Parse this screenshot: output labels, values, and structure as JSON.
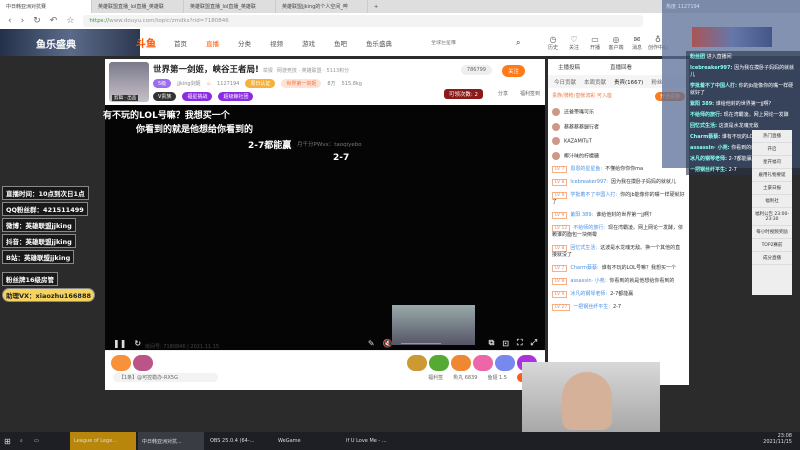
{
  "browser": {
    "tabs": [
      "中日韩亚洲对抗赛",
      "英雄联盟直播_lol直播_英雄联",
      "英雄联盟直播_lol直播_英雄联",
      "英雄联盟jjking的个人空间_哔"
    ],
    "url_secure": "https://",
    "url_rest": "www.douyu.com/topic/zmdks?rid=7180846"
  },
  "site": {
    "banner": "鱼乐盛典",
    "logo": "斗鱼",
    "nav": [
      "首页",
      "直播",
      "分类",
      "视频",
      "游戏",
      "鱼吧",
      "鱼乐盛典"
    ],
    "active_nav": "直播",
    "search_placeholder": "全球巨星推",
    "icons": [
      "历史",
      "关注",
      "开播",
      "客户端",
      "消息",
      "创作中心"
    ]
  },
  "room": {
    "title": "世界第一剑姬，峡谷王者局!",
    "tag": "举报",
    "category": "网游竞技 · 英雄联盟 · 5113积分",
    "level": "5级",
    "streamer": "jjking剑姬",
    "hot": "1127194",
    "badge1": "周日认证",
    "badge2": "世界第一剑姬",
    "followers": "8万",
    "weight": "515.8kg",
    "vip": "V贵族",
    "tag2": "福星挑战",
    "tag3": "超级鲸社团",
    "fans_count": "786799",
    "follow": "关注",
    "lottery": "可领次数: 2",
    "share": "分享",
    "report": "福利签到",
    "avatar_label": "剪辑 · 出品"
  },
  "video": {
    "subs": [
      "有不玩的LOL号嘛？我想买一个",
      "你看到的就是他想给你看到的",
      "2-7都能赢",
      "2-7"
    ],
    "faint": "月千分PWvx：taoqiyebo",
    "room_info": "房间号: 7180846 | 2021.11.15"
  },
  "left_overlay": [
    "直播时间：10点到次日1点",
    "QQ粉丝群：421511499",
    "微博：英雄联盟jjking",
    "抖音：英雄联盟jjking",
    "B站：英雄联盟jjking",
    "粉丝牌16级房管",
    "助理VX：xiaozhu166888"
  ],
  "giftbar": {
    "notice": "【1条】@可控勒办-RX5G",
    "items": [
      "福利签",
      "贡献榜",
      "魚丸 6839",
      "鱼翅 1.5",
      "充值"
    ]
  },
  "chat": {
    "top_tabs": [
      "主播投稿",
      "直播回看"
    ],
    "tabs": [
      "今日贡献",
      "本周贡献",
      "贵宾(1667)",
      "粉丝"
    ],
    "notice": "贵族/骑枪/皇帐流彩  可入座",
    "open": "开通贵族",
    "vips": [
      "还爸带嘴可乐",
      "蔡蔡蔡蔡腿行者",
      "KAZAMITuT",
      "椰汁味的柠檬糖"
    ],
    "messages": [
      {
        "lv": "LV 7",
        "name": "恩恩的星星鱼:",
        "text": "不懂给你你你ma"
      },
      {
        "lv": "LV 8",
        "name": "Icebreaker997:",
        "text": "因为我在摸卧子妈妈的就就儿"
      },
      {
        "lv": "LV 9",
        "name": "学批着不了中国人打:",
        "text": "你的jb能像你的嘴一样硬就好了"
      },
      {
        "lv": "LV 9",
        "name": "紫阳 389:",
        "text": "谁给他封的世界第一jj啊?"
      },
      {
        "lv": "LV 12",
        "name": "不给师的旅行:",
        "text": "现在湾霸凌。网上网论一发酵，依赖谁的面包一块倒霉"
      },
      {
        "lv": "LV 8",
        "name": "回忆式生活:",
        "text": "这波是水龙魂无敌。换一个其他的直接就没了"
      },
      {
        "lv": "LV 7",
        "name": "Charm蔡蔡:",
        "text": "谁有不玩的LOL号嘛？我想买一个"
      },
      {
        "lv": "LV 8",
        "name": "assassin· 小苑:",
        "text": "你看到的就是他想给你看到的"
      },
      {
        "lv": "LV 9",
        "name": "冰凡的钢琴老师:",
        "text": "2-7都能赢"
      },
      {
        "lv": "LV 27",
        "name": "一把钢丝纤平生:",
        "text": "2-7"
      }
    ]
  },
  "overlay": {
    "stats": "热度 1127194",
    "lines": [
      [
        "粉丝团",
        "进入直播间"
      ],
      [
        "Icebreaker997:",
        "因为我在摸卧子妈妈的就就儿"
      ],
      [
        "学批着不了中国人打:",
        "你的jb能像你的嘴一样硬就好了"
      ],
      [
        "紫阳 389:",
        "谁给他封的世界第一jj啊?"
      ],
      [
        "不给师的旅行:",
        "现在湾霸凌。网上网论一发酵"
      ],
      [
        "回忆式生活:",
        "这波是水龙魂无敌"
      ],
      [
        "Charm蔡蔡:",
        "谁有不玩的LOL号嘛?"
      ],
      [
        "assassin· 小苑:",
        "你看到的就是他想给你看到"
      ],
      [
        "冰凡的钢琴老师:",
        "2-7都能赢"
      ],
      [
        "一把钢丝纤平生:",
        "2-7"
      ]
    ]
  },
  "rail": [
    "热门直播",
    "开启",
    "星开福司",
    "雇用礼物要诞",
    "土豪日报",
    "福利社",
    "福利公告 23:00-23:30",
    "每小时视频奖励",
    "TOP2赛前",
    "成分直播"
  ],
  "taskbar": {
    "apps": [
      "League of Lege...",
      "中日韩亚洲对抗...",
      "OBS 25.0.4 (64-...",
      "WeGame",
      "If U Love Me - ..."
    ],
    "time": "23:08",
    "date": "2021/11/15"
  },
  "colors": {
    "accent": "#ff7a1a"
  }
}
